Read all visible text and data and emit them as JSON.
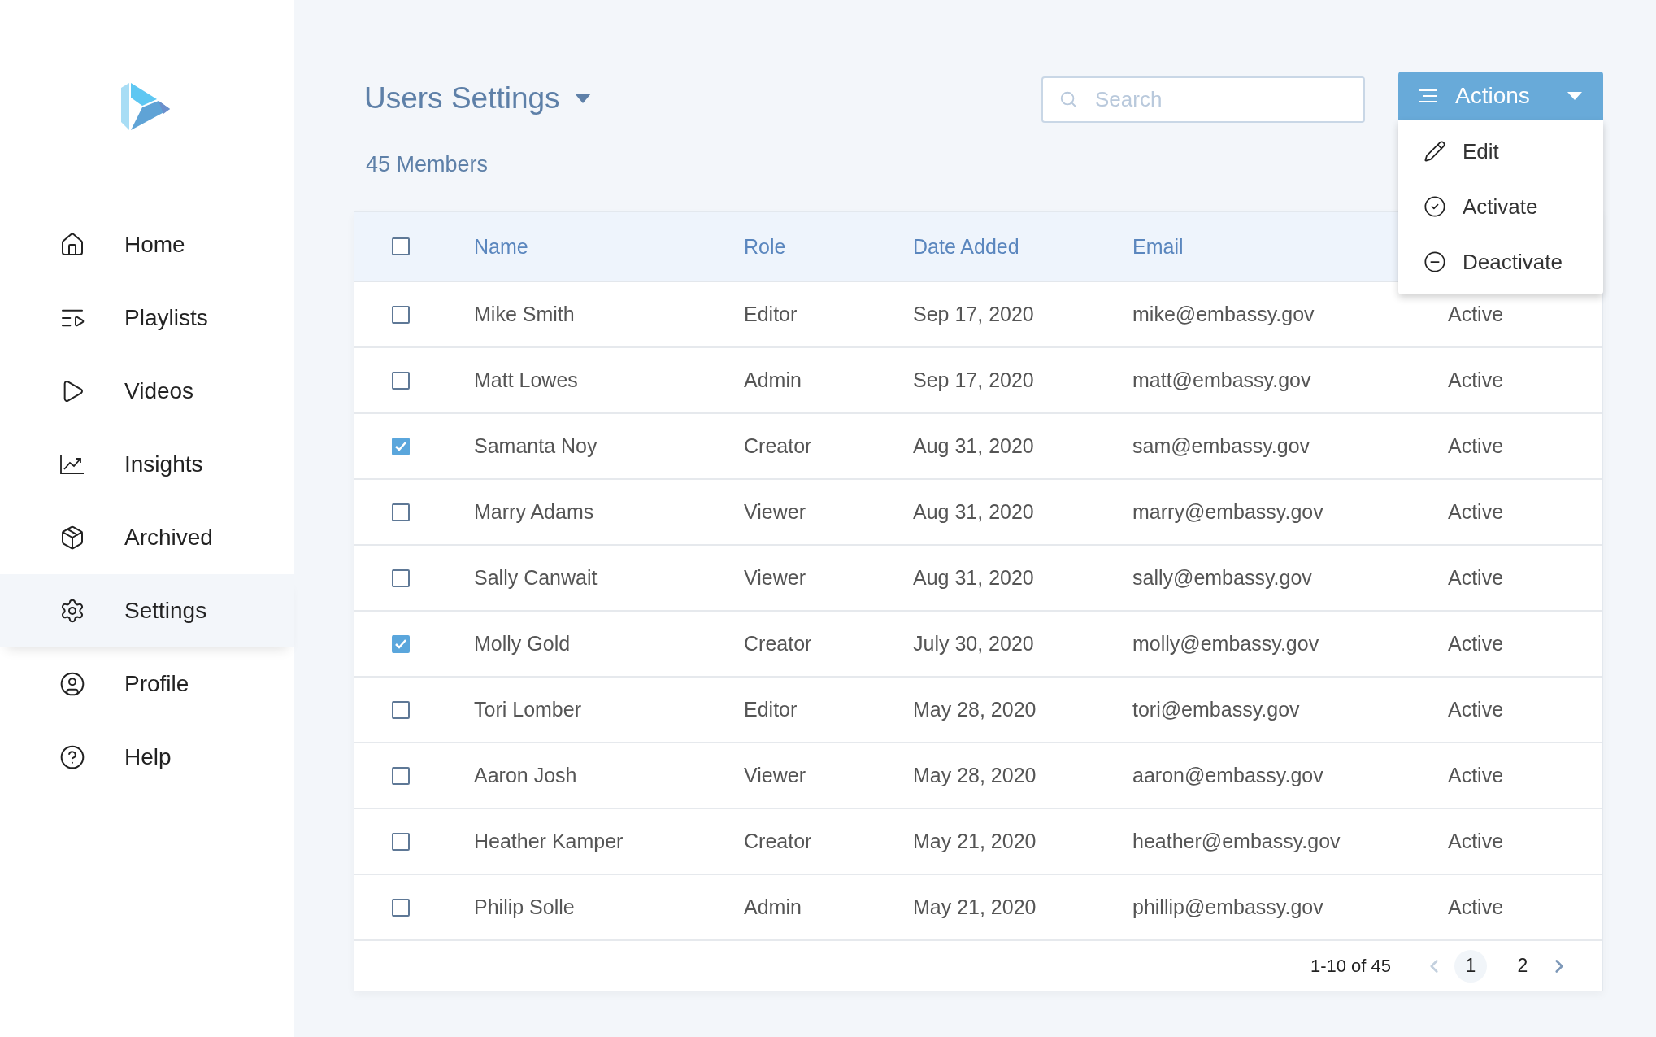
{
  "sidebar": {
    "items": [
      {
        "label": "Home",
        "selected": false
      },
      {
        "label": "Playlists",
        "selected": false
      },
      {
        "label": "Videos",
        "selected": false
      },
      {
        "label": "Insights",
        "selected": false
      },
      {
        "label": "Archived",
        "selected": false
      },
      {
        "label": "Settings",
        "selected": true
      },
      {
        "label": "Profile",
        "selected": false
      },
      {
        "label": "Help",
        "selected": false
      }
    ]
  },
  "header": {
    "title": "Users Settings",
    "members": "45 Members",
    "search": {
      "placeholder": "Search"
    },
    "actions": {
      "label": "Actions",
      "expanded": true,
      "menu": [
        {
          "kind": "edit",
          "label": "Edit"
        },
        {
          "kind": "activate",
          "label": "Activate"
        },
        {
          "kind": "deactivate",
          "label": "Deactivate"
        }
      ]
    }
  },
  "table": {
    "select_all": {
      "checked": false
    },
    "columns": [
      "Name",
      "Role",
      "Date Added",
      "Email"
    ],
    "rows": [
      {
        "checked": false,
        "name": "Mike Smith",
        "role": "Editor",
        "date": "Sep 17, 2020",
        "email": "mike@embassy.gov",
        "column_5": "Active"
      },
      {
        "checked": false,
        "name": "Matt Lowes",
        "role": "Admin",
        "date": "Sep 17, 2020",
        "email": "matt@embassy.gov",
        "column_5": "Active"
      },
      {
        "checked": true,
        "name": "Samanta Noy",
        "role": "Creator",
        "date": "Aug 31, 2020",
        "email": "sam@embassy.gov",
        "column_5": "Active"
      },
      {
        "checked": false,
        "name": "Marry Adams",
        "role": "Viewer",
        "date": "Aug 31, 2020",
        "email": "marry@embassy.gov",
        "column_5": "Active"
      },
      {
        "checked": false,
        "name": "Sally Canwait",
        "role": "Viewer",
        "date": "Aug 31, 2020",
        "email": "sally@embassy.gov",
        "column_5": "Active"
      },
      {
        "checked": true,
        "name": "Molly Gold",
        "role": "Creator",
        "date": "July 30, 2020",
        "email": "molly@embassy.gov",
        "column_5": "Active"
      },
      {
        "checked": false,
        "name": "Tori Lomber",
        "role": "Editor",
        "date": "May 28, 2020",
        "email": "tori@embassy.gov",
        "column_5": "Active"
      },
      {
        "checked": false,
        "name": "Aaron Josh",
        "role": "Viewer",
        "date": "May 28, 2020",
        "email": "aaron@embassy.gov",
        "column_5": "Active"
      },
      {
        "checked": false,
        "name": "Heather Kamper",
        "role": "Creator",
        "date": "May 21, 2020",
        "email": "heather@embassy.gov",
        "column_5": "Active"
      },
      {
        "checked": false,
        "name": "Philip Solle",
        "role": "Admin",
        "date": "May 21, 2020",
        "email": "phillip@embassy.gov",
        "column_5": "Active"
      }
    ],
    "pagination": {
      "range": "1-10 of 45",
      "pages": [
        {
          "label": "1",
          "selected": true
        },
        {
          "label": "2",
          "selected": false
        }
      ]
    }
  }
}
